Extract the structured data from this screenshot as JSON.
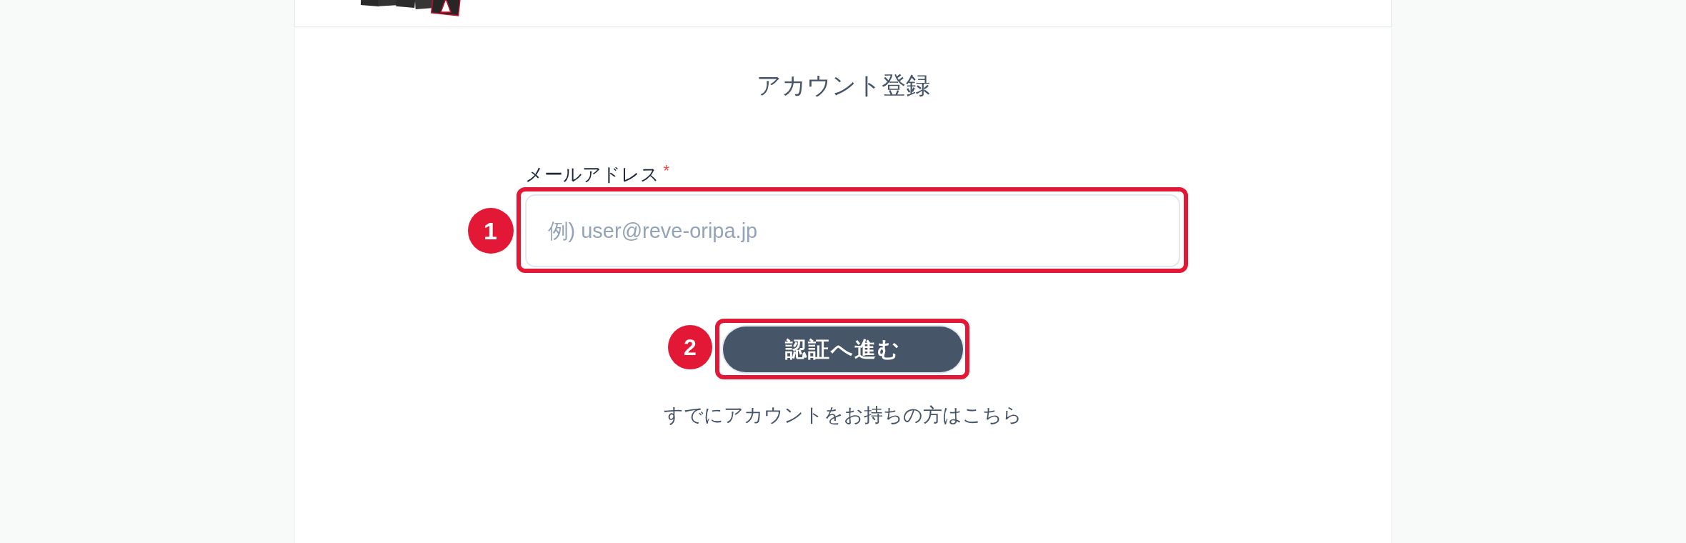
{
  "form": {
    "title": "アカウント登録",
    "fields": [
      {
        "label": "メールアドレス",
        "required_mark": "*",
        "placeholder": "例) user@reve-oripa.jp",
        "callout": "1"
      }
    ],
    "submit": {
      "label": "認証へ進む",
      "callout": "2"
    },
    "login_link": "すでにアカウントをお持ちの方はこちら"
  }
}
